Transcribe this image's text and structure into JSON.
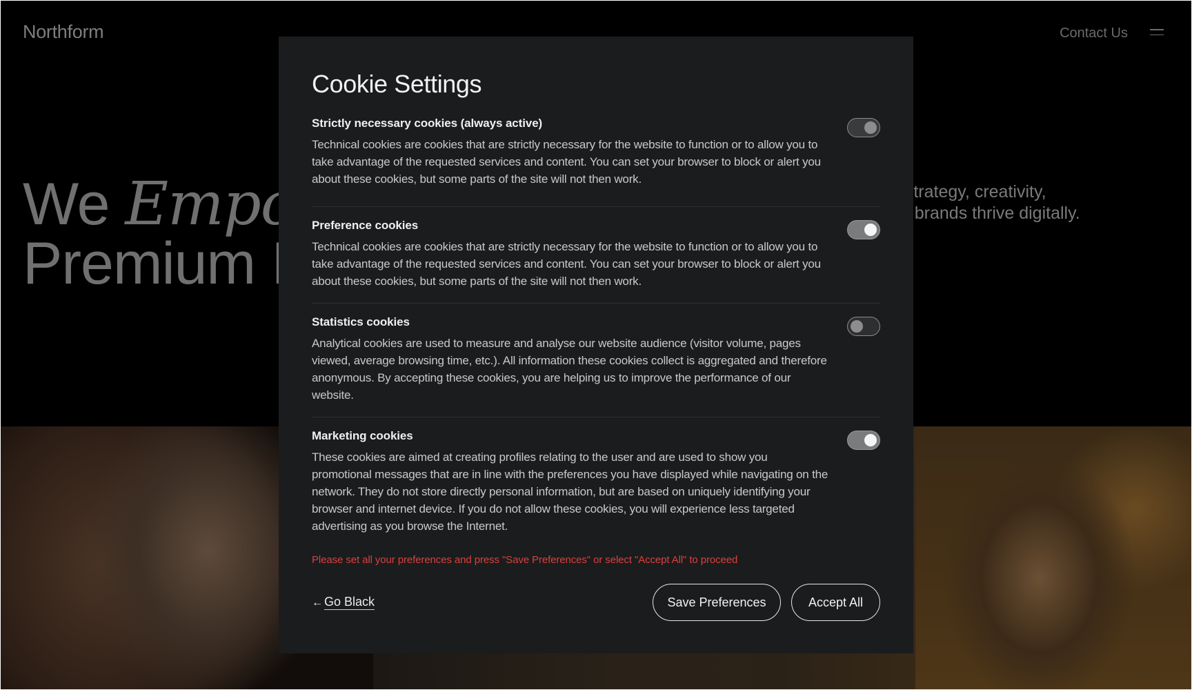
{
  "header": {
    "brand": "Northform",
    "contact_label": "Contact Us",
    "menu_icon": "menu-icon"
  },
  "hero": {
    "title_line1_plain": "We ",
    "title_line1_italic": "Empo",
    "title_line2": "Premium I",
    "subtitle_line1": "h strategy, creativity,",
    "subtitle_line2": "ng brands thrive digitally."
  },
  "modal": {
    "title": "Cookie Settings",
    "sections": [
      {
        "title": "Strictly necessary cookies (always active)",
        "description": "Technical cookies are cookies that are strictly necessary for the website to function or to allow you to take advantage of the requested services and content. You can set your browser to block or alert you about these cookies, but some parts of the site will not then work.",
        "toggle_state": "locked-on"
      },
      {
        "title": "Preference cookies",
        "description": "Technical cookies are cookies that are strictly necessary for the website to function or to allow you to take advantage of the requested services and content. You can set your browser to block or alert you about these cookies, but some parts of the site will not then work.",
        "toggle_state": "on"
      },
      {
        "title": "Statistics cookies",
        "description": "Analytical cookies are used to measure and analyse our website audience (visitor volume, pages viewed, average browsing time, etc.). All information these cookies collect is aggregated and therefore anonymous. By accepting these cookies, you are helping us to improve the performance of our website.",
        "toggle_state": "off"
      },
      {
        "title": "Marketing cookies",
        "description": "These cookies are aimed at creating profiles relating to the user and are used to show you promotional messages that are in line with the preferences you have displayed while navigating on the network. They do not store directly personal information, but are based on uniquely identifying your browser and internet device. If you do not allow these cookies, you will experience less targeted advertising as you browse the Internet.",
        "toggle_state": "on"
      }
    ],
    "notice": "Please set all your preferences and press \"Save Preferences\" or select \"Accept All\" to proceed",
    "back_arrow": "←",
    "back_label": "Go Black",
    "save_label": "Save Preferences",
    "accept_label": "Accept All"
  },
  "colors": {
    "modal_bg": "#1b1c1e",
    "notice_red": "#d9413b",
    "page_bg": "#000000"
  }
}
